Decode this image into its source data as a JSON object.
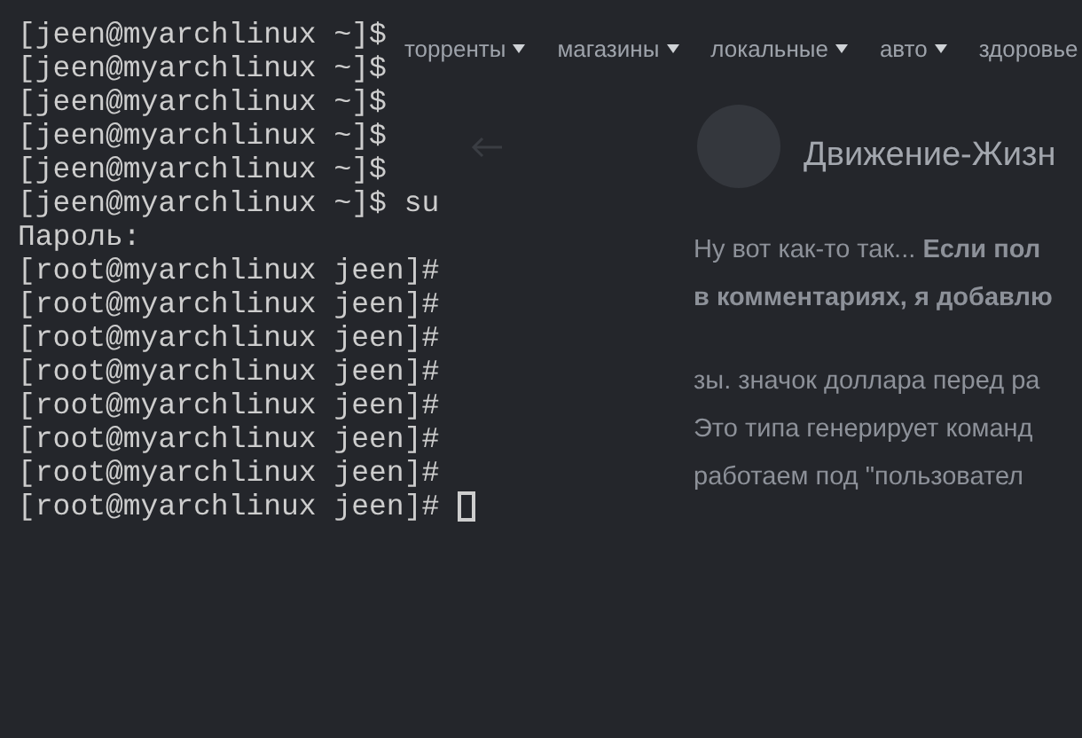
{
  "web_page": {
    "nav": [
      {
        "label": "торренты"
      },
      {
        "label": "магазины"
      },
      {
        "label": "локальные"
      },
      {
        "label": "авто"
      },
      {
        "label": "здоровье"
      }
    ],
    "post": {
      "author_name": "Движение-Жизн",
      "paragraphs": [
        [
          "Ну вот как-то так... **Если пол**",
          "**в комментариях, я добавлю**"
        ],
        [
          "зы. значок доллара перед ра",
          "Это типа генерирует команд",
          "работаем под \"пользовател"
        ]
      ]
    }
  },
  "terminal": {
    "lines": [
      "[jeen@myarchlinux ~]$",
      "[jeen@myarchlinux ~]$",
      "[jeen@myarchlinux ~]$",
      "[jeen@myarchlinux ~]$",
      "[jeen@myarchlinux ~]$",
      "[jeen@myarchlinux ~]$ su",
      "Пароль:",
      "[root@myarchlinux jeen]#",
      "[root@myarchlinux jeen]#",
      "[root@myarchlinux jeen]#",
      "[root@myarchlinux jeen]#",
      "[root@myarchlinux jeen]#",
      "[root@myarchlinux jeen]#",
      "[root@myarchlinux jeen]#",
      "[root@myarchlinux jeen]#"
    ]
  }
}
